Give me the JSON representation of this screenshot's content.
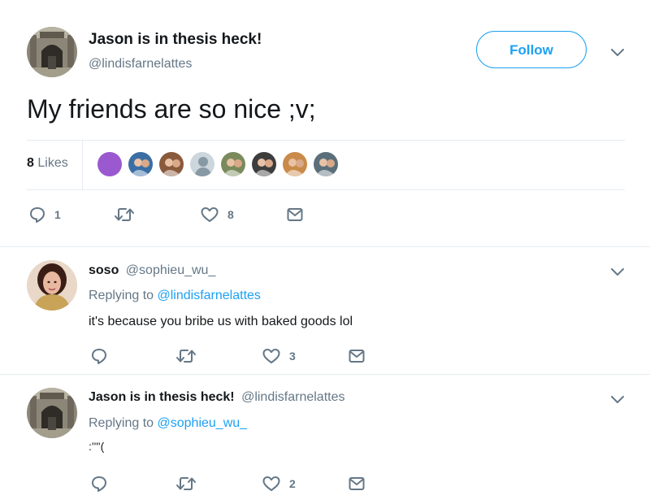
{
  "main_tweet": {
    "display_name": "Jason is in thesis heck!",
    "handle": "@lindisfarnelattes",
    "follow_label": "Follow",
    "text": "My friends are so nice ;v;",
    "likes": {
      "count": "8",
      "label": "Likes"
    },
    "likers": [
      {
        "name": "liker-1",
        "color": "#9b59d0"
      },
      {
        "name": "liker-2",
        "color": "#3a6ea5"
      },
      {
        "name": "liker-3",
        "color": "#8a5a3c"
      },
      {
        "name": "liker-4",
        "color": "#aab8c2"
      },
      {
        "name": "liker-5",
        "color": "#7a8a5c"
      },
      {
        "name": "liker-6",
        "color": "#3d3d3d"
      },
      {
        "name": "liker-7",
        "color": "#c98a4a"
      },
      {
        "name": "liker-8",
        "color": "#5b6f7a"
      }
    ],
    "actions": {
      "reply_count": "1",
      "retweet_count": "",
      "like_count": "8"
    }
  },
  "replies": [
    {
      "display_name": "soso",
      "handle": "@sophieu_wu_",
      "replying_prefix": "Replying to",
      "replying_to": "@lindisfarnelattes",
      "text": "it's because you bribe us with baked goods lol",
      "actions": {
        "reply_count": "",
        "retweet_count": "",
        "like_count": "3"
      }
    },
    {
      "display_name": "Jason is in thesis heck!",
      "handle": "@lindisfarnelattes",
      "replying_prefix": "Replying to",
      "replying_to": "@sophieu_wu_",
      "text": ":''''(",
      "actions": {
        "reply_count": "",
        "retweet_count": "",
        "like_count": "2"
      }
    }
  ],
  "colors": {
    "accent": "#1da1f2",
    "text_primary": "#14171a",
    "text_secondary": "#657786",
    "divider": "#e6ecf0"
  },
  "icons": [
    "reply-icon",
    "retweet-icon",
    "like-icon",
    "dm-icon",
    "chevron-down-icon"
  ]
}
